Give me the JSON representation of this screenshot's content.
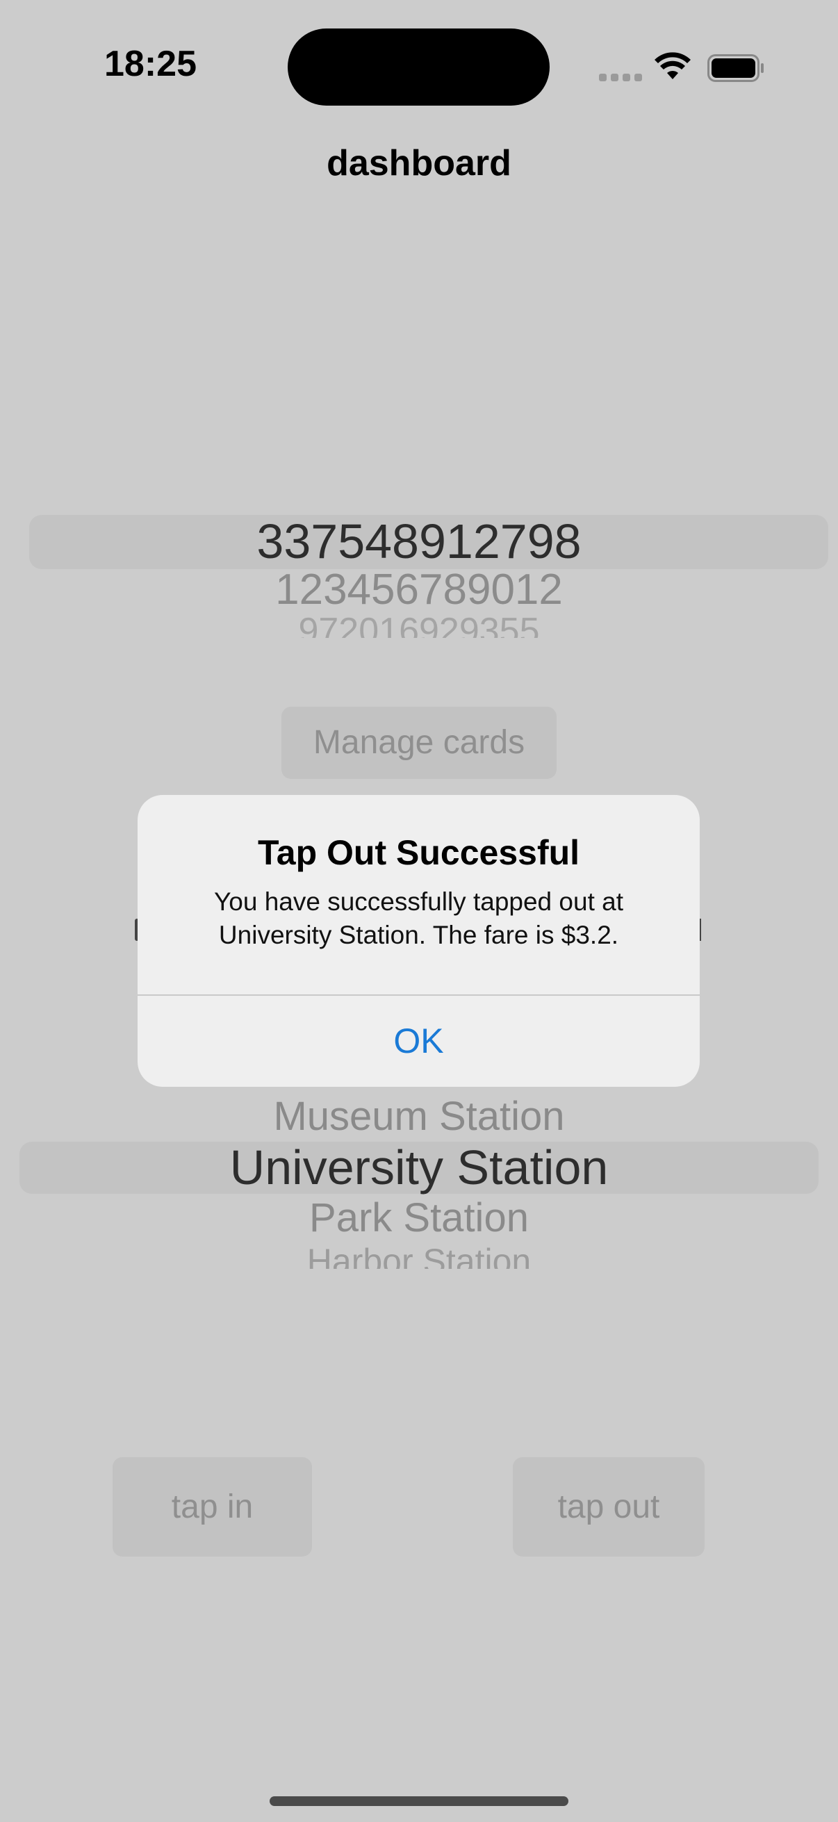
{
  "status_bar": {
    "time": "18:25",
    "icons": [
      "cellular-signal-icon",
      "wifi-icon",
      "battery-icon"
    ]
  },
  "nav": {
    "title": "dashboard"
  },
  "card_picker": {
    "selected": "337548912798",
    "options_below": [
      "123456789012",
      "972016929355"
    ]
  },
  "manage_cards": {
    "label": "Manage cards"
  },
  "station_picker": {
    "options_above": [
      "Museum Station"
    ],
    "selected": "University Station",
    "options_below": [
      "Park Station",
      "Harbor Station"
    ]
  },
  "actions": {
    "tap_in": "tap in",
    "tap_out": "tap out"
  },
  "alert": {
    "title": "Tap Out Successful",
    "message": "You have successfully tapped out at University Station. The fare is $3.2.",
    "ok_label": "OK"
  },
  "colors": {
    "background": "#cccccc",
    "alert_background": "#efefef",
    "accent": "#1a7ad6",
    "dimmed_text": "#8f8f8f"
  }
}
